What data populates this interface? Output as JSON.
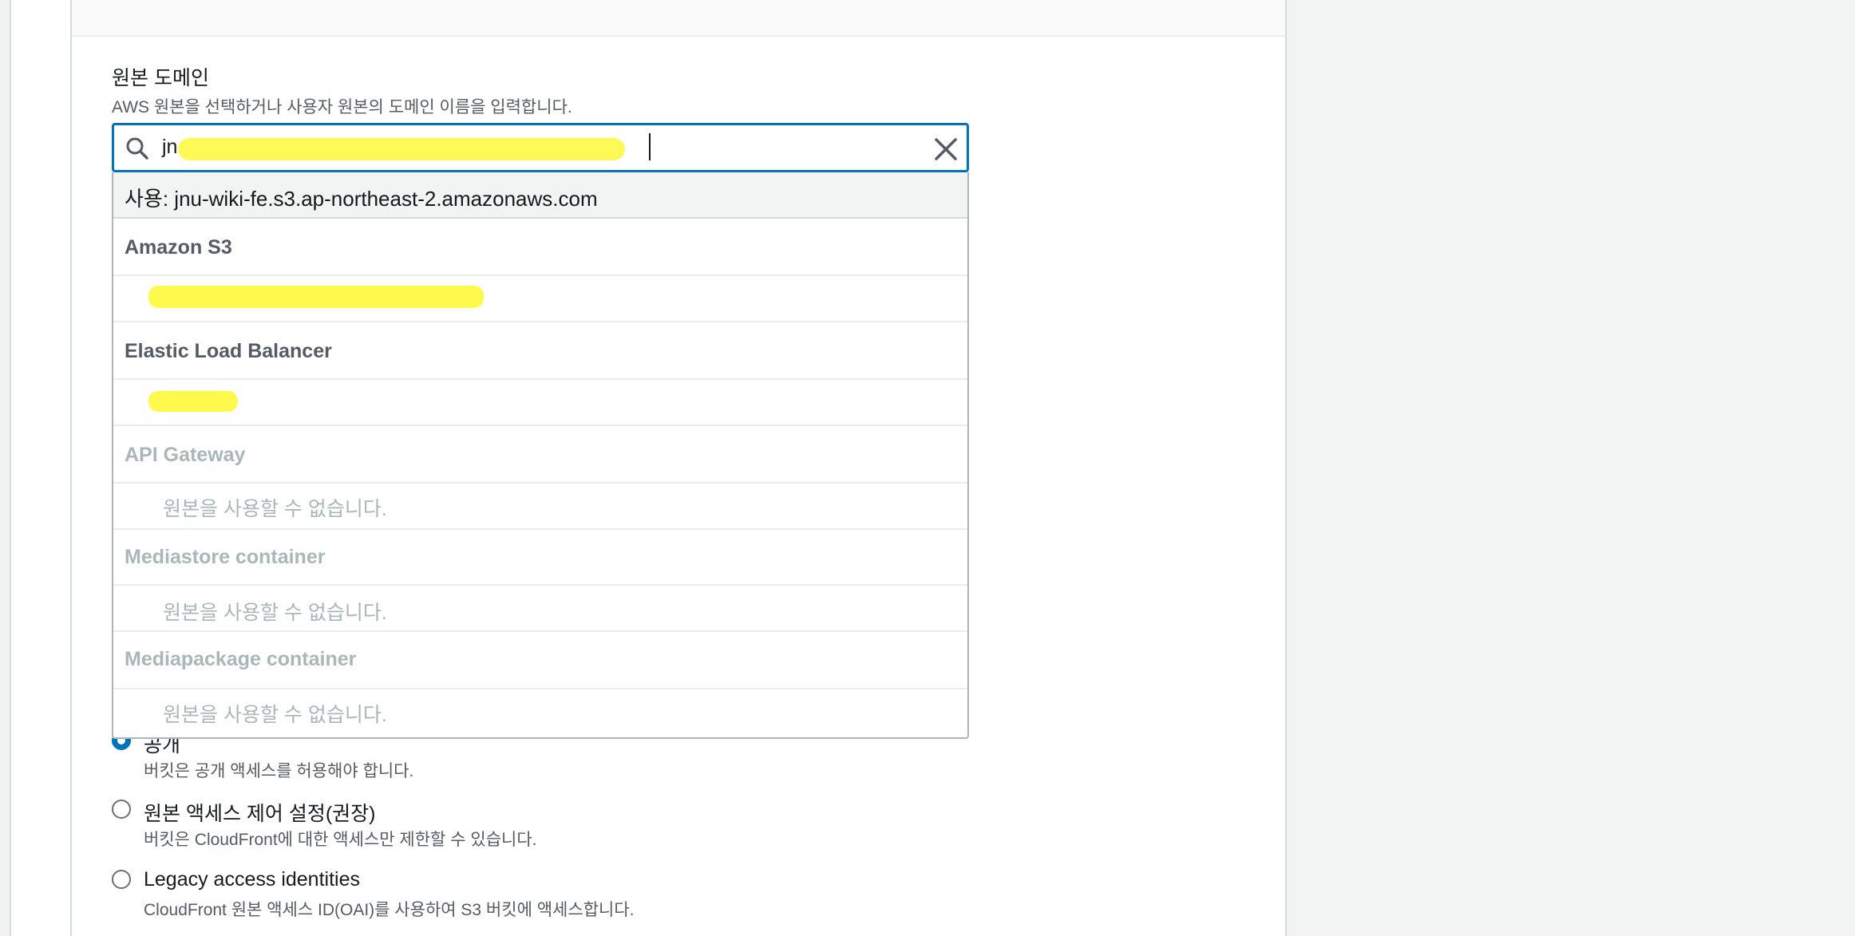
{
  "origin_domain": {
    "label": "원본 도메인",
    "description": "AWS 원본을 선택하거나 사용자 원본의 도메인 이름을 입력합니다.",
    "input_value": "jn"
  },
  "dropdown": {
    "use_option": "사용: jnu-wiki-fe.s3.ap-northeast-2.amazonaws.com",
    "groups": [
      {
        "label": "Amazon S3"
      },
      {
        "label": "Elastic Load Balancer"
      },
      {
        "label": "API Gateway",
        "empty_text": "원본을 사용할 수 없습니다."
      },
      {
        "label": "Mediastore container",
        "empty_text": "원본을 사용할 수 없습니다."
      },
      {
        "label": "Mediapackage container",
        "empty_text": "원본을 사용할 수 없습니다."
      }
    ]
  },
  "access": {
    "options": [
      {
        "label": "공개",
        "description": "버킷은 공개 액세스를 허용해야 합니다.",
        "checked": true
      },
      {
        "label": "원본 액세스 제어 설정(권장)",
        "description": "버킷은 CloudFront에 대한 액세스만 제한할 수 있습니다.",
        "checked": false
      },
      {
        "label": "Legacy access identities",
        "description": "CloudFront 원본 액세스 ID(OAI)를 사용하여 S3 버킷에 액세스합니다.",
        "checked": false
      }
    ]
  },
  "colors": {
    "accent": "#0073bb",
    "redaction": "#fff94d"
  }
}
